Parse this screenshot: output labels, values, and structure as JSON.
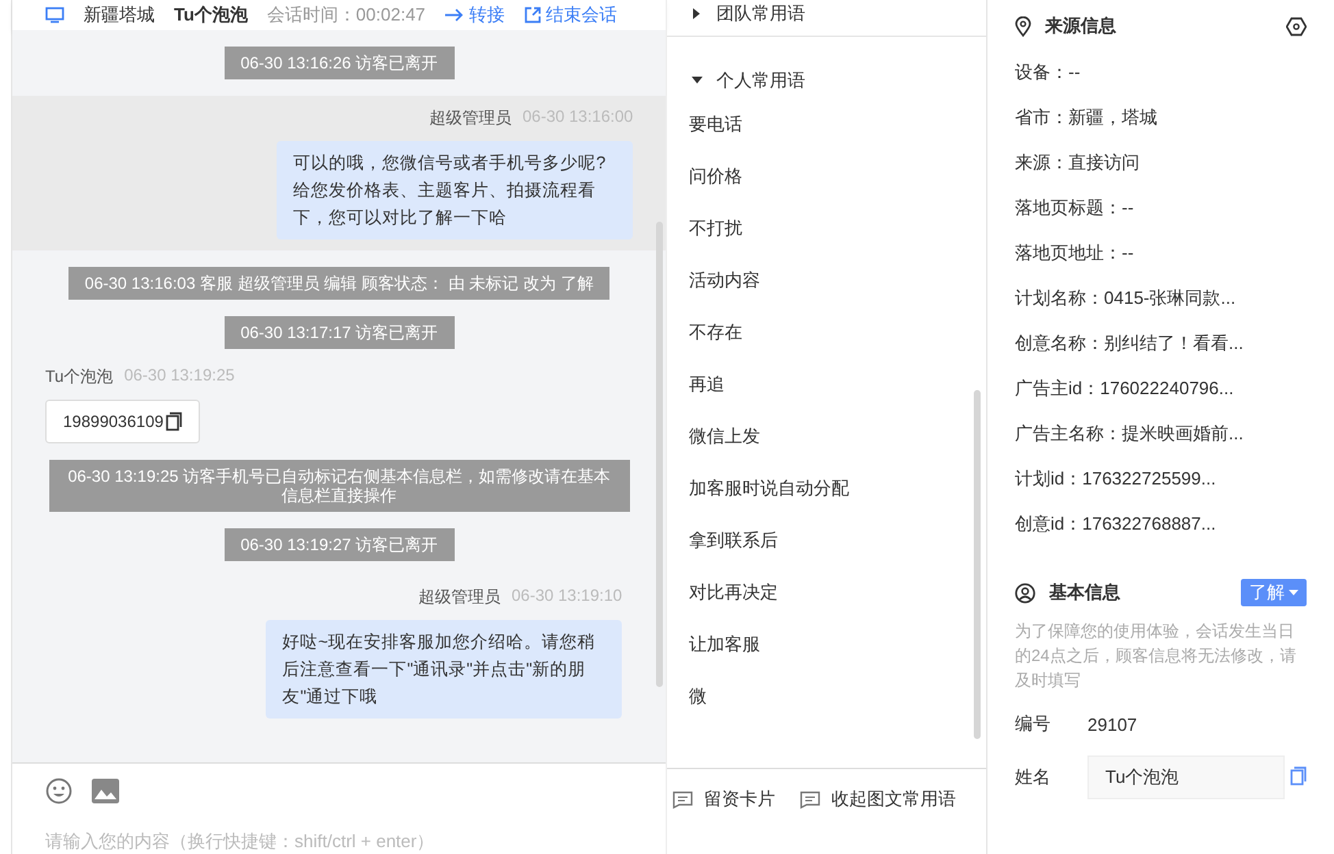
{
  "header": {
    "location": "新疆塔城",
    "visitor": "Tu个泡泡",
    "duration": "会话时间：00:02:47",
    "actions": [
      "转接",
      "结束会话"
    ]
  },
  "messages": [
    {
      "kind": "system",
      "text": "06-30 13:16:26 访客已离开"
    },
    {
      "kind": "agent",
      "highlighted": true,
      "sender": "超级管理员",
      "time": "06-30 13:16:00",
      "text": "可以的哦，您微信号或者手机号多少呢?给您发价格表、主题客片、拍摄流程看下，您可以对比了解一下哈"
    },
    {
      "kind": "system",
      "text": "06-30 13:16:03 客服 超级管理员 编辑 顾客状态： 由 未标记 改为 了解"
    },
    {
      "kind": "system",
      "text": "06-30 13:17:17 访客已离开"
    },
    {
      "kind": "visitor",
      "sender": "Tu个泡泡",
      "time": "06-30 13:19:25",
      "text": "19899036109"
    },
    {
      "kind": "system",
      "text": "06-30 13:19:25 访客手机号已自动标记右侧基本信息栏，如需修改请在基本信息栏直接操作"
    },
    {
      "kind": "system",
      "text": "06-30 13:19:27 访客已离开"
    },
    {
      "kind": "agent",
      "highlighted": false,
      "sender": "超级管理员",
      "time": "06-30 13:19:10",
      "text": "好哒~现在安排客服加您介绍哈。请您稍后注意查看一下\"通讯录\"并点击\"新的朋友\"通过下哦"
    }
  ],
  "input": {
    "placeholder": "请输入您的内容（换行快捷键：shift/ctrl + enter）"
  },
  "phrases": {
    "groups": [
      {
        "label": "团队常用语",
        "expanded": false
      },
      {
        "label": "个人常用语",
        "expanded": true
      }
    ],
    "items": [
      "要电话",
      "问价格",
      "不打扰",
      "活动内容",
      "不存在",
      "再追",
      "微信上发",
      "加客服时说自动分配",
      "拿到联系后",
      "对比再决定",
      "让加客服",
      "微"
    ],
    "buttons": [
      "留资卡片",
      "收起图文常用语"
    ]
  },
  "source": {
    "title": "来源信息",
    "rows": [
      "设备：--",
      "省市：新疆，塔城",
      "来源：直接访问",
      "落地页标题：--",
      "落地页地址：--",
      "计划名称：0415-张琳同款...",
      "创意名称：别纠结了！看看...",
      "广告主id：176022240796...",
      "广告主名称：提米映画婚前...",
      "计划id：176322725599...",
      "创意id：176322768887..."
    ]
  },
  "basic": {
    "title": "基本信息",
    "status": "了解",
    "notice": "为了保障您的使用体验，会话发生当日的24点之后，顾客信息将无法修改，请及时填写",
    "fields": [
      {
        "kind": "text",
        "label": "编号",
        "value": "29107"
      },
      {
        "kind": "input",
        "label": "姓名",
        "value": "Tu个泡泡"
      }
    ]
  }
}
